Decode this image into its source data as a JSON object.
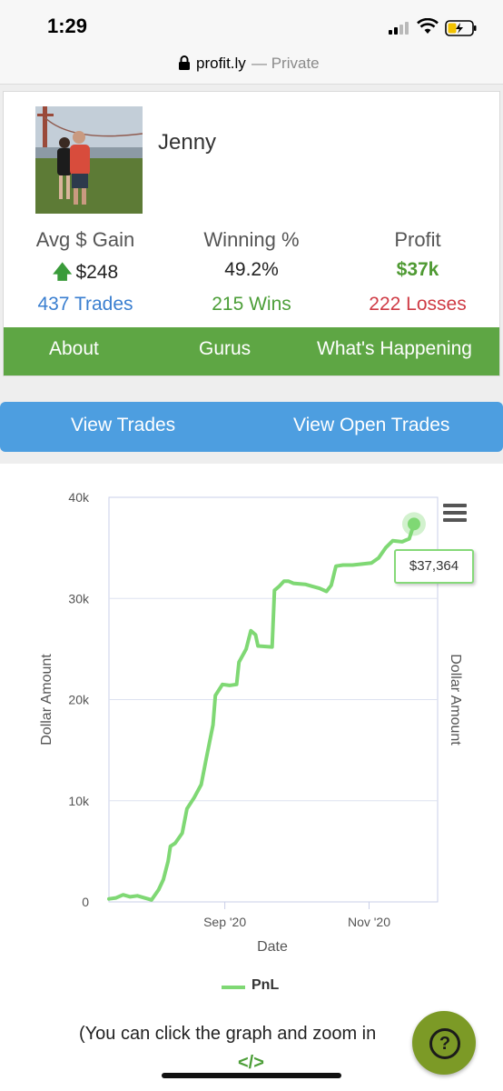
{
  "status_bar": {
    "time": "1:29"
  },
  "url_bar": {
    "domain": "profit.ly",
    "separator_label": "— Private"
  },
  "profile": {
    "name": "Jenny",
    "stats": {
      "avg_gain_label": "Avg $ Gain",
      "avg_gain_value": "$248",
      "winning_label": "Winning %",
      "winning_value": "49.2%",
      "profit_label": "Profit",
      "profit_value": "$37k"
    },
    "links": {
      "trades": "437 Trades",
      "wins": "215 Wins",
      "losses": "222 Losses"
    }
  },
  "green_nav": {
    "about": "About",
    "gurus": "Gurus",
    "whats_happening": "What's Happening"
  },
  "blue_bar": {
    "view_trades": "View Trades",
    "view_open_trades": "View Open Trades"
  },
  "colors": {
    "profit_green": "#4f9a33",
    "nav_green": "#5ea644",
    "button_blue": "#4d9ee0",
    "line_green": "#7fd874",
    "loss_red": "#cf3b45"
  },
  "chart_data": {
    "type": "line",
    "ylabel": "Dollar Amount",
    "xlabel": "Date",
    "yticks": [
      "0",
      "10k",
      "20k",
      "30k",
      "40k"
    ],
    "ylim": [
      0,
      40000
    ],
    "xticks": [
      {
        "label": "Sep '20",
        "date": "2020-09-01"
      },
      {
        "label": "Nov '20",
        "date": "2020-11-01"
      }
    ],
    "xlim": [
      "2020-07-14",
      "2020-11-30"
    ],
    "grid": true,
    "legend_position": "bottom",
    "series": [
      {
        "name": "PnL",
        "color": "#7fd874",
        "points": [
          [
            "2020-07-14",
            300
          ],
          [
            "2020-07-17",
            400
          ],
          [
            "2020-07-20",
            700
          ],
          [
            "2020-07-23",
            500
          ],
          [
            "2020-07-26",
            600
          ],
          [
            "2020-07-29",
            400
          ],
          [
            "2020-08-01",
            200
          ],
          [
            "2020-08-04",
            1200
          ],
          [
            "2020-08-06",
            2200
          ],
          [
            "2020-08-08",
            4000
          ],
          [
            "2020-08-09",
            5500
          ],
          [
            "2020-08-11",
            5800
          ],
          [
            "2020-08-14",
            6800
          ],
          [
            "2020-08-16",
            9200
          ],
          [
            "2020-08-19",
            10300
          ],
          [
            "2020-08-22",
            11600
          ],
          [
            "2020-08-24",
            14000
          ],
          [
            "2020-08-27",
            17500
          ],
          [
            "2020-08-28",
            20400
          ],
          [
            "2020-08-31",
            21500
          ],
          [
            "2020-09-03",
            21400
          ],
          [
            "2020-09-06",
            21500
          ],
          [
            "2020-09-07",
            23700
          ],
          [
            "2020-09-10",
            25000
          ],
          [
            "2020-09-12",
            26800
          ],
          [
            "2020-09-14",
            26400
          ],
          [
            "2020-09-15",
            25300
          ],
          [
            "2020-09-21",
            25200
          ],
          [
            "2020-09-22",
            30800
          ],
          [
            "2020-09-24",
            31200
          ],
          [
            "2020-09-26",
            31700
          ],
          [
            "2020-09-28",
            31700
          ],
          [
            "2020-09-30",
            31500
          ],
          [
            "2020-10-05",
            31400
          ],
          [
            "2020-10-08",
            31200
          ],
          [
            "2020-10-11",
            31000
          ],
          [
            "2020-10-14",
            30700
          ],
          [
            "2020-10-16",
            31300
          ],
          [
            "2020-10-18",
            33200
          ],
          [
            "2020-10-21",
            33300
          ],
          [
            "2020-10-25",
            33300
          ],
          [
            "2020-10-29",
            33400
          ],
          [
            "2020-11-02",
            33500
          ],
          [
            "2020-11-05",
            34000
          ],
          [
            "2020-11-08",
            35000
          ],
          [
            "2020-11-11",
            35700
          ],
          [
            "2020-11-15",
            35600
          ],
          [
            "2020-11-18",
            35900
          ],
          [
            "2020-11-20",
            37364
          ]
        ]
      }
    ],
    "tooltip": {
      "date": "2020-11-20",
      "label": "$37,364"
    }
  },
  "footer": {
    "hint": "(You can click the graph and zoom in",
    "code_icon": "</>"
  }
}
